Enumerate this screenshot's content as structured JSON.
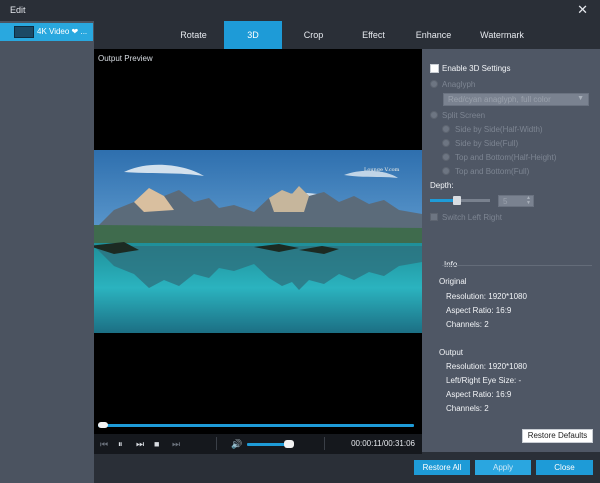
{
  "window": {
    "title": "Edit",
    "close_symbol": "✕"
  },
  "sidebar": {
    "items": [
      {
        "label": "4K Video ❤ ..."
      }
    ]
  },
  "tabs": [
    "Rotate",
    "3D",
    "Crop",
    "Effect",
    "Enhance",
    "Watermark"
  ],
  "active_tab": "3D",
  "preview": {
    "label": "Output Preview",
    "watermark": "Lounge V.com",
    "progress": 0.0,
    "volume": 0.85,
    "time": "00:00:11/00:31:06"
  },
  "settings": {
    "enable_3d": {
      "label": "Enable 3D Settings",
      "checked": false
    },
    "anaglyph": {
      "label": "Anaglyph",
      "value": "Red/cyan anaglyph, full color"
    },
    "split_screen": {
      "label": "Split Screen",
      "options": [
        "Side by Side(Half-Width)",
        "Side by Side(Full)",
        "Top and Bottom(Half-Height)",
        "Top and Bottom(Full)"
      ]
    },
    "depth": {
      "label": "Depth:",
      "value": "5"
    },
    "switch_left_right": "Switch Left Right"
  },
  "info": {
    "title": "Info",
    "original": {
      "heading": "Original",
      "resolution": "Resolution: 1920*1080",
      "aspect": "Aspect Ratio: 16:9",
      "channels": "Channels: 2"
    },
    "output": {
      "heading": "Output",
      "resolution": "Resolution: 1920*1080",
      "eye_size": "Left/Right Eye Size: -",
      "aspect": "Aspect Ratio: 16:9",
      "channels": "Channels: 2"
    }
  },
  "buttons": {
    "restore_defaults": "Restore Defaults",
    "restore_all": "Restore All",
    "apply": "Apply",
    "close": "Close"
  },
  "colors": {
    "accent": "#1e9bd7",
    "panel": "#4f5765",
    "dark": "#2a2f37"
  }
}
